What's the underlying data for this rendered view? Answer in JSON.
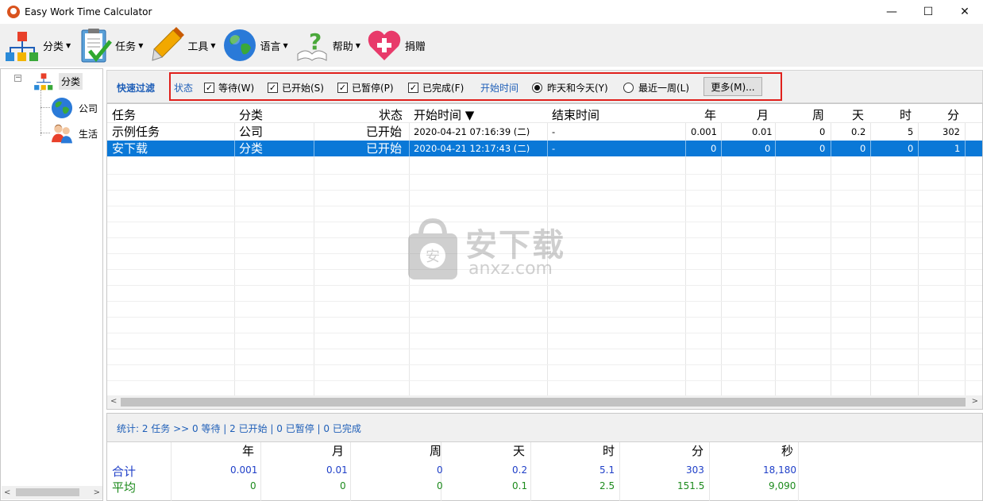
{
  "window": {
    "title": "Easy Work Time Calculator",
    "minimize": "—",
    "maximize": "☐",
    "close": "✕"
  },
  "toolbar": {
    "items": [
      {
        "label": "分类",
        "icon": "org-chart-icon"
      },
      {
        "label": "任务",
        "icon": "clipboard-check-icon"
      },
      {
        "label": "工具",
        "icon": "pen-tool-icon"
      },
      {
        "label": "语言",
        "icon": "globe-icon"
      },
      {
        "label": "帮助",
        "icon": "help-question-icon"
      },
      {
        "label": "捐赠",
        "icon": "heart-plus-icon"
      }
    ]
  },
  "tree": {
    "toggle": "−",
    "root": "分类",
    "children": [
      "公司",
      "生活"
    ]
  },
  "filter": {
    "quick_filter": "快速过滤",
    "status_label": "状态",
    "checks": [
      {
        "label": "等待(W)",
        "checked": true
      },
      {
        "label": "已开始(S)",
        "checked": true
      },
      {
        "label": "已暂停(P)",
        "checked": true
      },
      {
        "label": "已完成(F)",
        "checked": true
      }
    ],
    "start_time_label": "开始时间",
    "radios": [
      {
        "label": "昨天和今天(Y)",
        "selected": true
      },
      {
        "label": "最近一周(L)",
        "selected": false
      }
    ],
    "more_button": "更多(M)..."
  },
  "grid": {
    "columns": [
      "任务",
      "分类",
      "状态",
      "开始时间 ▼",
      "结束时间",
      "年",
      "月",
      "周",
      "天",
      "时",
      "分"
    ],
    "rows": [
      {
        "task": "示例任务",
        "category": "公司",
        "status": "已开始",
        "start": "2020-04-21 07:16:39 (二)",
        "end": "-",
        "year": "0.001",
        "month": "0.01",
        "week": "0",
        "day": "0.2",
        "hour": "5",
        "minute": "302",
        "selected": false
      },
      {
        "task": "安下载",
        "category": "分类",
        "status": "已开始",
        "start": "2020-04-21 12:17:43 (二)",
        "end": "-",
        "year": "0",
        "month": "0",
        "week": "0",
        "day": "0",
        "hour": "0",
        "minute": "1",
        "selected": true
      }
    ],
    "scroll_left": "<",
    "scroll_right": ">"
  },
  "watermark": {
    "brand": "安下载",
    "domain": "anxz.com"
  },
  "summary": {
    "stats": "统计: 2 任务 >> 0 等待 | 2 已开始 | 0 已暂停 | 0 已完成",
    "headers": [
      "年",
      "月",
      "周",
      "天",
      "时",
      "分",
      "秒"
    ],
    "total_label": "合计",
    "total": [
      "0.001",
      "0.01",
      "0",
      "0.2",
      "5.1",
      "303",
      "18,180"
    ],
    "avg_label": "平均",
    "avg": [
      "0",
      "0",
      "0",
      "0.1",
      "2.5",
      "151.5",
      "9,090"
    ]
  },
  "colors": {
    "accent_blue": "#1f5fb8",
    "selection": "#0a78d7",
    "highlight_red": "#e0201c",
    "avg_green": "#1c8a1c"
  }
}
